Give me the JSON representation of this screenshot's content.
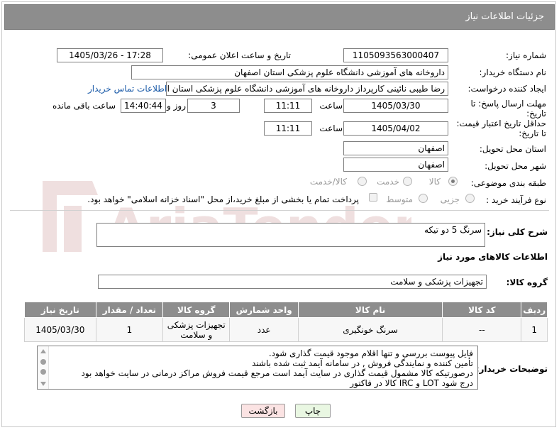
{
  "header": {
    "title": "جزئیات اطلاعات نیاز"
  },
  "form": {
    "need_number_label": "شماره نیاز:",
    "need_number": "1105093563000407",
    "announce_label": "تاریخ و ساعت اعلان عمومی:",
    "announce_value": "1405/03/26 - 17:28",
    "buyer_org_label": "نام دستگاه خریدار:",
    "buyer_org": "داروخانه های آموزشی دانشگاه علوم پزشکی استان اصفهان",
    "creator_label": "ایجاد کننده درخواست:",
    "creator": "رضا طیبی نائینی کارپرداز داروخانه های آموزشی دانشگاه علوم پزشکی استان اصفهان",
    "contact_link": "اطلاعات تماس خریدار",
    "deadline_label_1": "مهلت ارسال پاسخ: تا",
    "deadline_label_2": "تاریخ:",
    "deadline_date": "1405/03/30",
    "time_label": "ساعت",
    "deadline_time": "11:11",
    "days_value": "3",
    "days_label": "روز و",
    "remaining_value": "14:40:44",
    "remaining_label": "ساعت باقی مانده",
    "validity_label_1": "حداقل تاریخ اعتبار قیمت:",
    "validity_label_2": "تا تاریخ:",
    "validity_date": "1405/04/02",
    "validity_time": "11:11",
    "province_label": "استان محل تحویل:",
    "province": "اصفهان",
    "city_label": "شهر محل تحویل:",
    "city": "اصفهان",
    "category_label": "طبقه بندی موضوعی:",
    "category_options": [
      "کالا",
      "خدمت",
      "کالا/خدمت"
    ],
    "category_selected": "کالا",
    "process_label": "نوع فرآیند خرید :",
    "process_options": [
      "جزیی",
      "متوسط"
    ],
    "payment_note": "پرداخت تمام یا بخشی از مبلغ خرید،از محل \"اسناد خزانه اسلامی\" خواهد بود."
  },
  "summary": {
    "label": "شرح کلی نیاز:",
    "value": "سرنگ 5 دو تیکه"
  },
  "goods": {
    "section_title": "اطلاعات کالاهای مورد نیاز",
    "group_label": "گروه کالا:",
    "group_value": "تجهیزات پزشکی و سلامت",
    "columns": [
      "ردیف",
      "کد کالا",
      "نام کالا",
      "واحد شمارش",
      "گروه کالا",
      "تعداد / مقدار",
      "تاریخ نیاز"
    ],
    "rows": [
      {
        "row": "1",
        "code": "--",
        "name": "سرنگ خونگیری",
        "unit": "عدد",
        "group": "تجهیزات پزشکی و سلامت",
        "qty": "1",
        "date": "1405/03/30"
      }
    ]
  },
  "notes": {
    "label": "توضیحات خریدار:",
    "lines": [
      "فایل پیوست بررسی و تنها اقلام موجود قیمت گذاری شود.",
      "تأمین کننده و نمایندگی فروش , در سامانه آیمد ثبت شده باشند",
      "درصورتیکه کالا مشمول قیمت گذاری در سایت آیمد است مرجع قیمت فروش مراکز درمانی در سایت خواهد بود",
      "درج شود LOT و IRC کالا در فاکتور"
    ]
  },
  "buttons": {
    "print": "چاپ",
    "back": "بازگشت"
  },
  "watermark": {
    "text": "AriaTender.neT"
  },
  "colors": {
    "header_bg": "#8d8d8d",
    "link": "#1a5aa8",
    "print_btn": "#e9f7e2",
    "back_btn": "#fbe3e3"
  }
}
